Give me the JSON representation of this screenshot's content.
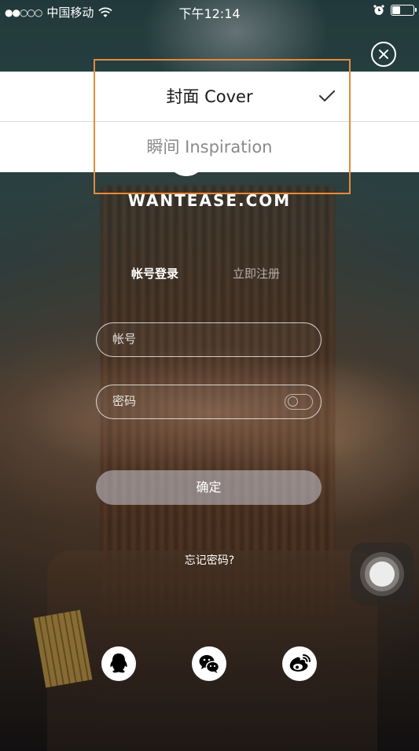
{
  "status_bar": {
    "signal": "●●○○○",
    "carrier": "中国移动",
    "time": "下午12:14",
    "battery_level": 0.35
  },
  "menu": {
    "items": [
      {
        "label": "封面 Cover",
        "selected": true
      },
      {
        "label": "瞬间 Inspiration",
        "selected": false
      }
    ]
  },
  "brand": {
    "text": "WANTEASE.COM"
  },
  "tabs": {
    "login": "帐号登录",
    "register": "立即注册"
  },
  "form": {
    "account_placeholder": "帐号",
    "password_placeholder": "密码",
    "submit_label": "确定",
    "forgot_label": "忘记密码?"
  },
  "social": {
    "icons": [
      "qq-icon",
      "wechat-icon",
      "weibo-icon"
    ]
  },
  "colors": {
    "highlight": "#e68a3a",
    "menu_background": "#ffffff"
  }
}
